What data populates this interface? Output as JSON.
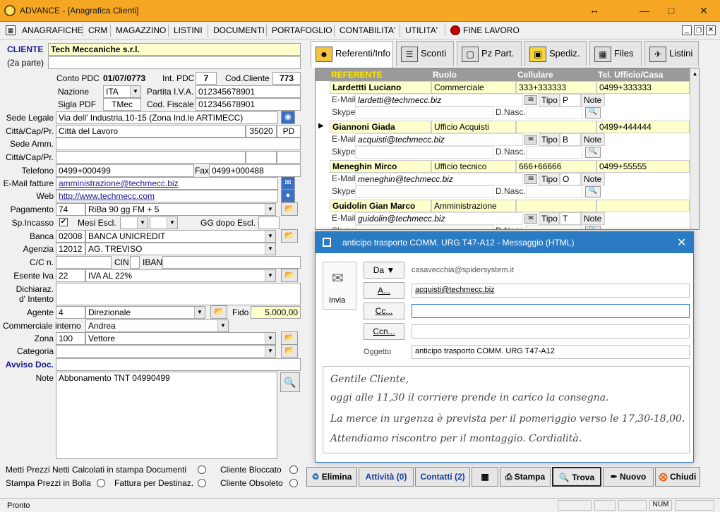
{
  "window": {
    "title": "ADVANCE - [Anagrafica Clienti]",
    "resize_icon": "↔"
  },
  "menu": [
    "ANAGRAFICHE",
    "CRM",
    "MAGAZZINO",
    "LISTINI",
    "DOCUMENTI",
    "PORTAFOGLIO",
    "CONTABILITA'",
    "UTILITA'",
    "FINE LAVORO"
  ],
  "client": {
    "cliente_label": "CLIENTE",
    "cliente_value": "Tech Meccaniche s.r.l.",
    "seconda_label": "(2a parte)",
    "conto_pdc_label": "Conto PDC",
    "conto_pdc_value": "01/07/0773",
    "int_pdc_label": "Int. PDC",
    "int_pdc_value": "7",
    "cod_cliente_label": "Cod.Cliente",
    "cod_cliente_value": "773",
    "nazione_label": "Nazione",
    "nazione_value": "ITA",
    "piva_label": "Partita I.V.A.",
    "piva_value": "012345678901",
    "sigla_pdf_label": "Sigla PDF",
    "sigla_pdf_value": "TMec",
    "cod_fiscale_label": "Cod. Fiscale",
    "cod_fiscale_value": "012345678901",
    "sede_legale_label": "Sede Legale",
    "sede_legale_value": "Via dell' Industria,10-15 (Zona Ind.le ARTIMECC)",
    "citta_label": "Città/Cap/Pr.",
    "citta_value": "Città del Lavoro",
    "cap_value": "35020",
    "pr_value": "PD",
    "sede_amm_label": "Sede Amm.",
    "citta2_label": "Città/Cap/Pr.",
    "telefono_label": "Telefono",
    "telefono_value": "0499+000499",
    "fax_label": "Fax",
    "fax_value": "0499+000488",
    "email_label": "E-Mail fatture",
    "email_value": "amministrazione@techmecc.biz",
    "web_label": "Web",
    "web_value": "http://www.techmecc.com",
    "pagamento_label": "Pagamento",
    "pagamento_code": "74",
    "pagamento_value": "RiBa 90 gg FM + 5",
    "sp_incasso_label": "Sp.Incasso",
    "mesi_escl_label": "Mesi Escl.",
    "gg_dopo_label": "GG dopo Escl.",
    "check_mark": "✔",
    "banca_label": "Banca",
    "banca_code": "02008",
    "banca_value": "BANCA UNICREDIT",
    "agenzia_label": "Agenzia",
    "agenzia_code": "12012",
    "agenzia_value": "AG. TREVISO",
    "cc_label": "C/C n.",
    "cin_label": "CIN",
    "iban_label": "IBAN",
    "esente_label": "Esente Iva",
    "esente_code": "22",
    "esente_value": "IVA AL 22%",
    "dichiaraz_label": "Dichiaraz.",
    "dintento_label": "d' Intento",
    "agente_label": "Agente",
    "agente_code": "4",
    "agente_value": "Direzionale",
    "fido_label": "Fido",
    "fido_value": "5.000,00",
    "comm_label": "Commerciale interno",
    "comm_value": "Andrea",
    "zona_label": "Zona",
    "zona_code": "100",
    "zona_value": "Vettore",
    "categoria_label": "Categoria",
    "avviso_label": "Avviso Doc.",
    "note_label": "Note",
    "note_value": "Abbonamento TNT 04990499",
    "opt1": "Metti Prezzi Netti Calcolati in stampa Documenti",
    "opt2": "Cliente Bloccato",
    "opt3": "Stampa Prezzi in Bolla",
    "opt4": "Fattura per Destinaz.",
    "opt5": "Cliente Obsoleto"
  },
  "tabs": [
    "Referenti/Info",
    "Sconti",
    "Pz Part.",
    "Spediz.",
    "Files",
    "Listini"
  ],
  "grid": {
    "headers": [
      "REFERENTE",
      "Ruolo",
      "Cellulare",
      "Tel. Ufficio/Casa"
    ],
    "email_label": "E-Mail",
    "skype_label": "Skype",
    "tipo_label": "Tipo",
    "note_label": "Note",
    "dnasc_label": "D.Nasc.",
    "rows": [
      {
        "name": "Lardettti Luciano",
        "ruolo": "Commerciale",
        "cell": "333+333333",
        "tel": "0499+333333",
        "email": "lardetti@techmecc.biz",
        "tipo": "P"
      },
      {
        "name": "Giannoni Giada",
        "ruolo": "Ufficio Acquisti",
        "cell": "",
        "tel": "0499+444444",
        "email": "acquisti@techmecc.biz",
        "tipo": "B"
      },
      {
        "name": "Meneghin Mirco",
        "ruolo": "Ufficio tecnico",
        "cell": "666+66666",
        "tel": "0499+55555",
        "email": "meneghin@techmecc.biz",
        "tipo": "O"
      },
      {
        "name": "Guidolin Gian Marco",
        "ruolo": "Amministrazione",
        "cell": "",
        "tel": "",
        "email": "guidolin@techmecc.biz",
        "tipo": "T"
      }
    ]
  },
  "email": {
    "title": "anticipo trasporto COMM. URG T47-A12  -  Messaggio (HTML)",
    "send": "Invia",
    "da": "Da",
    "a": "A...",
    "cc": "Cc...",
    "ccn": "Ccn...",
    "oggetto_label": "Oggetto",
    "from": "casavecchia@spidersystem.it",
    "to": "acquisti@techmecc.biz",
    "subject": "anticipo  trasporto COMM. URG T47-A12",
    "lines": [
      "Gentile Cliente,",
      "oggi alle 11,30 il corriere prende in carico la consegna.",
      "La merce in urgenza è prevista per il pomeriggio verso le 17,30-18,00.",
      "Attendiamo riscontro per il montaggio.     Cordialità."
    ]
  },
  "buttons": [
    "Elimina",
    "Attività (0)",
    "Contatti (2)",
    "Stampa",
    "Trova",
    "Nuovo",
    "Chiudi"
  ],
  "status": {
    "text": "Pronto",
    "num": "NUM"
  }
}
